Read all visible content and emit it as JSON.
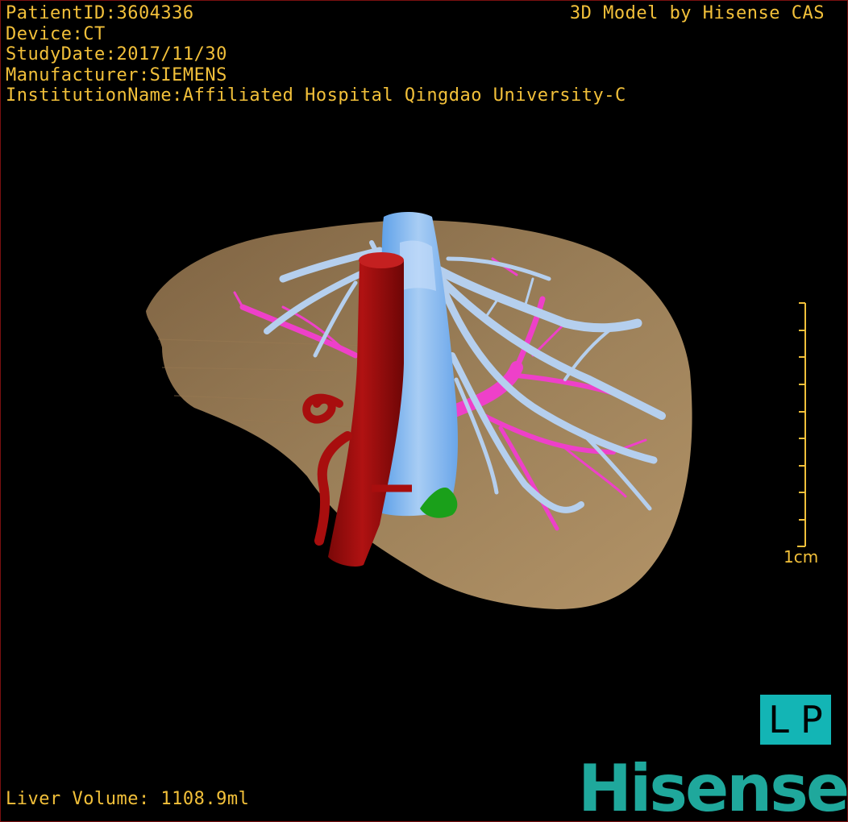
{
  "overlay": {
    "patient_id": "PatientID:3604336",
    "device": "Device:CT",
    "study_date": "StudyDate:2017/11/30",
    "manufacturer": "Manufacturer:SIEMENS",
    "institution": "InstitutionName:Affiliated Hospital Qingdao University-C",
    "credit": "3D Model by Hisense CAS",
    "liver_volume": "Liver Volume: 1108.9ml"
  },
  "scale_bar": {
    "label": "1cm"
  },
  "orientation": {
    "left": "L",
    "right": "P"
  },
  "brand": {
    "logo_text": "Hisense"
  },
  "colors": {
    "overlay_text": "#f2c03a",
    "liver": "#a5845b",
    "hepatic_vein": "#b5cfee",
    "portal_vein": "#ee40c9",
    "vena_cava": "#7fb5f0",
    "aorta": "#a80e0e",
    "gallbladder": "#1aa01a",
    "orientation_cube": "#13b5b5",
    "brand": "#1fa89c"
  }
}
